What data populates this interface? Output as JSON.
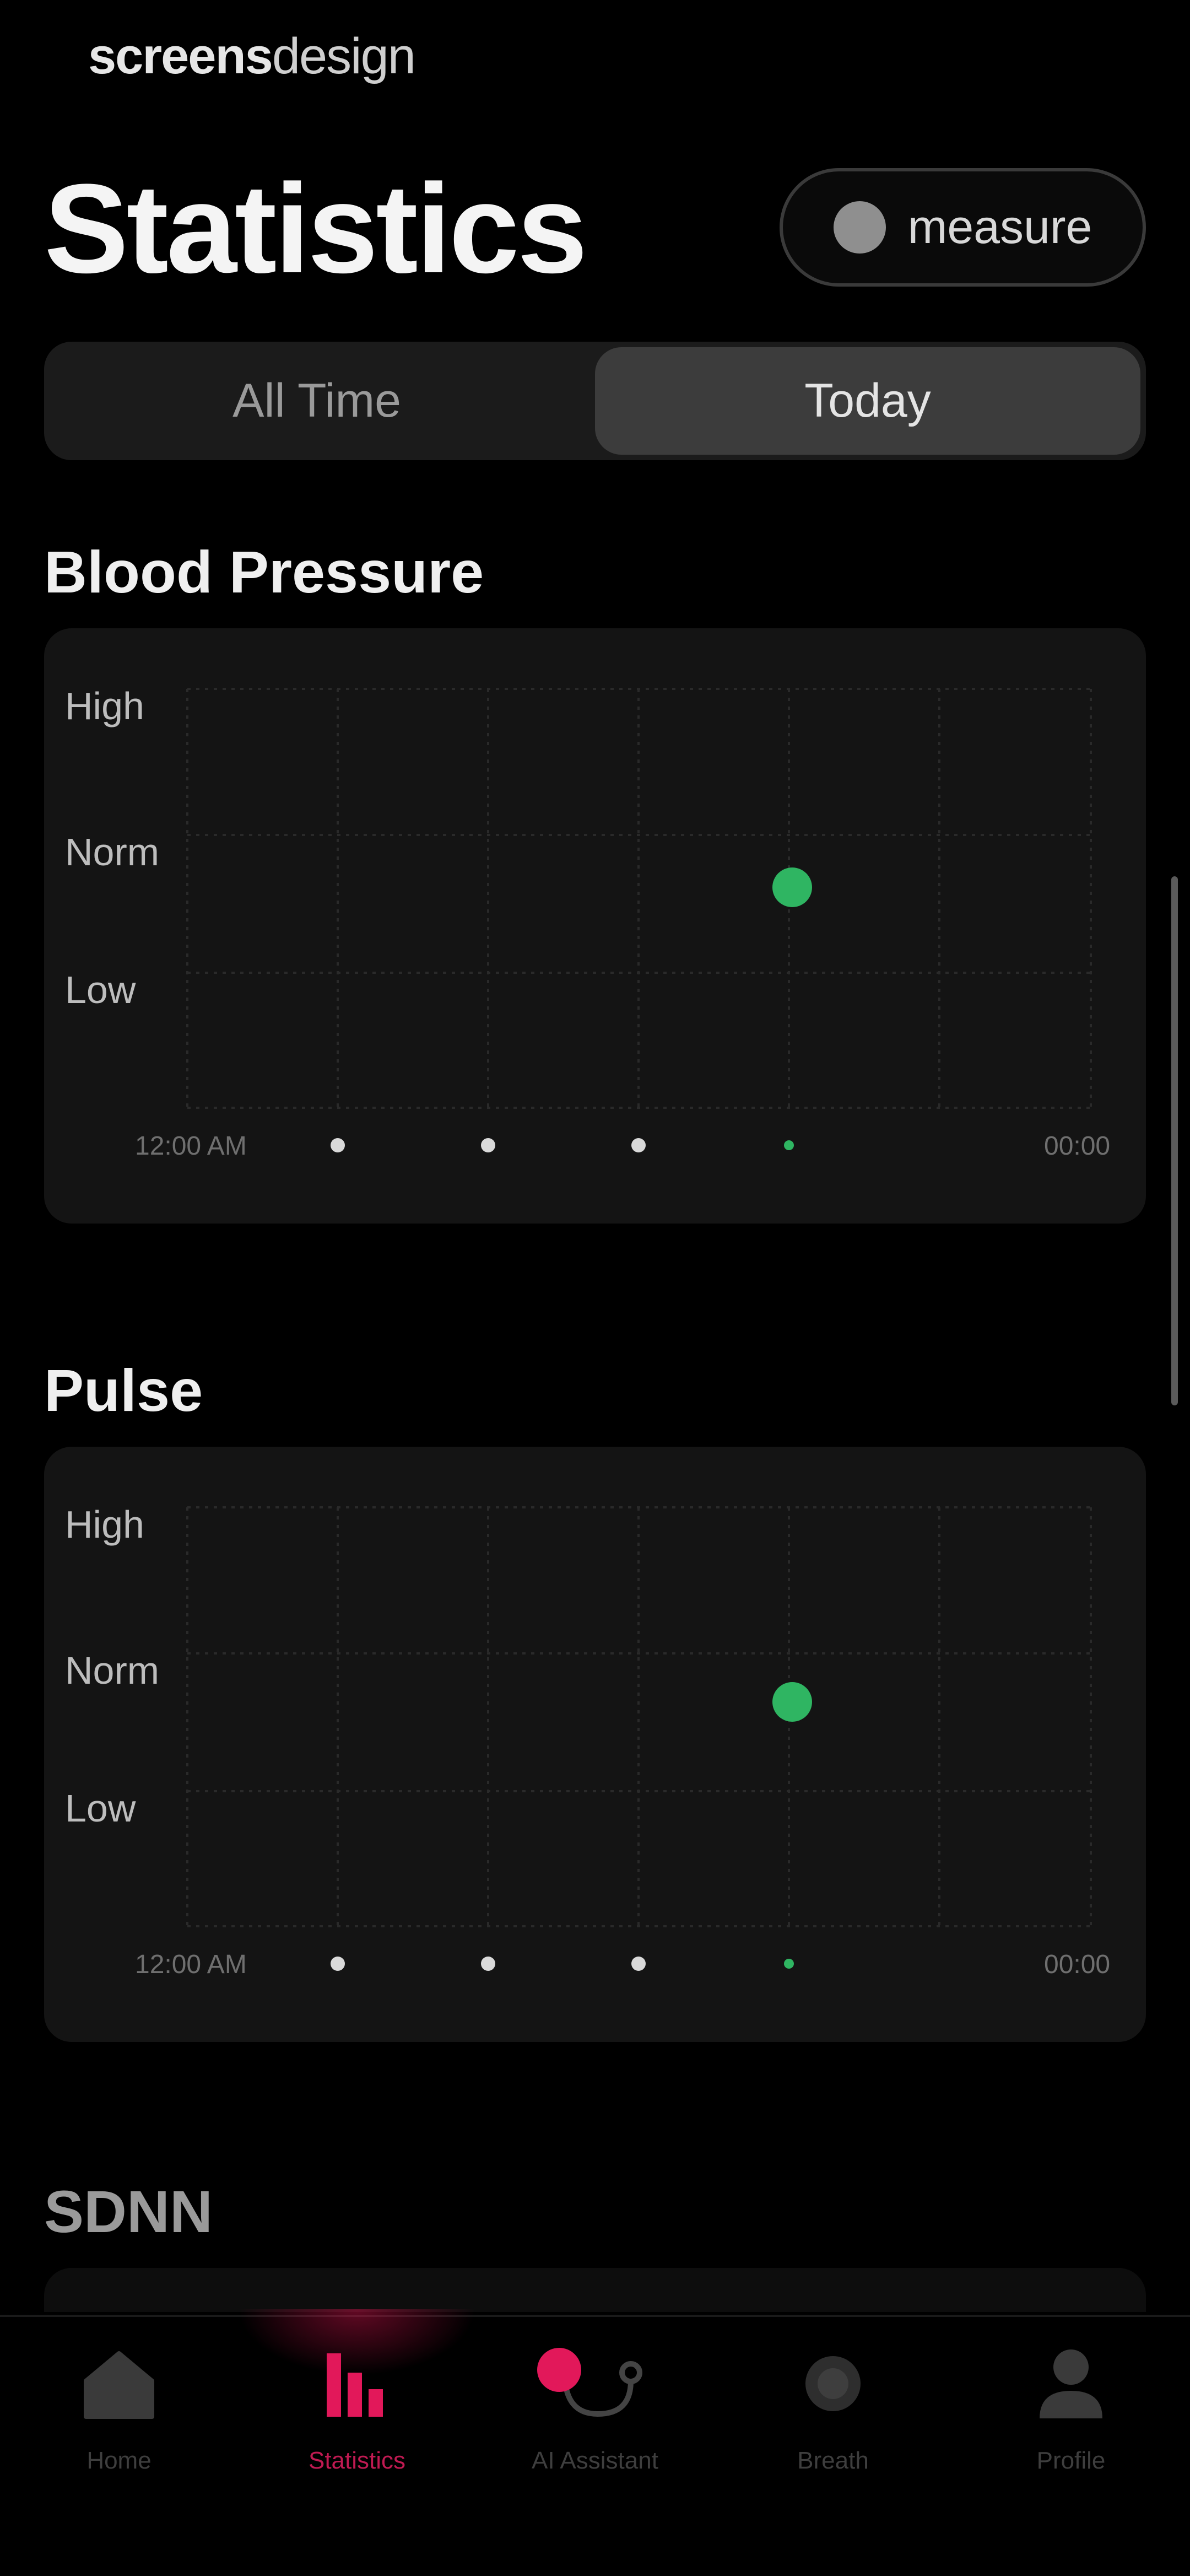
{
  "brand": {
    "part1": "screens",
    "part2": "design"
  },
  "page_title": "Statistics",
  "measure_button": {
    "label": "measure"
  },
  "segmented": {
    "options": [
      "All Time",
      "Today"
    ],
    "selected": "Today"
  },
  "colors": {
    "accent": "#e2185a",
    "normal_point": "#2fb562",
    "card_bg": "#141414"
  },
  "sections": [
    {
      "title": "Blood Pressure",
      "y_levels": [
        "High",
        "Norm",
        "Low"
      ],
      "x_start": "12:00 AM",
      "x_end": "00:00",
      "point_level": "between Norm and Low",
      "point_slot": 4
    },
    {
      "title": "Pulse",
      "y_levels": [
        "High",
        "Norm",
        "Low"
      ],
      "x_start": "12:00 AM",
      "x_end": "00:00",
      "point_level": "between Norm and Low",
      "point_slot": 4
    }
  ],
  "sdnn": {
    "title": "SDNN"
  },
  "tabbar": {
    "items": [
      {
        "label": "Home",
        "icon": "home-icon"
      },
      {
        "label": "Statistics",
        "icon": "bar-chart-icon",
        "active": true
      },
      {
        "label": "AI Assistant",
        "icon": "stethoscope-icon"
      },
      {
        "label": "Breath",
        "icon": "breath-icon"
      },
      {
        "label": "Profile",
        "icon": "profile-icon"
      }
    ]
  }
}
